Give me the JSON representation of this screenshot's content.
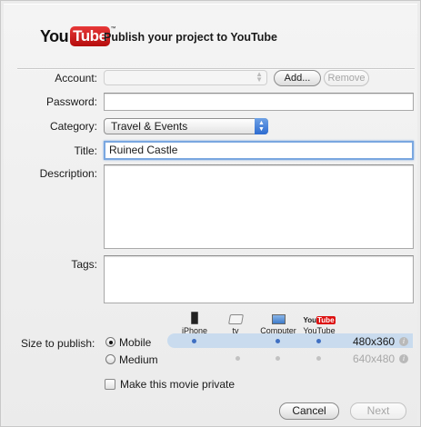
{
  "header": {
    "logo_you": "You",
    "logo_tube": "Tube",
    "logo_tm": "™",
    "title": "Publish your project to YouTube"
  },
  "account": {
    "label": "Account:",
    "add_label": "Add...",
    "remove_label": "Remove"
  },
  "password": {
    "label": "Password:",
    "value": ""
  },
  "category": {
    "label": "Category:",
    "value": "Travel & Events"
  },
  "title_field": {
    "label": "Title:",
    "value": "Ruined Castle"
  },
  "description": {
    "label": "Description:",
    "value": ""
  },
  "tags": {
    "label": "Tags:",
    "value": ""
  },
  "devices": [
    {
      "icon": "iphone-icon",
      "label": "iPhone"
    },
    {
      "icon": "apple-tv-icon",
      "label": "tv"
    },
    {
      "icon": "computer-icon",
      "label": "Computer"
    },
    {
      "icon": "youtube-icon",
      "label": "YouTube"
    }
  ],
  "size": {
    "label": "Size to publish:",
    "options": [
      {
        "label": "Mobile",
        "resolution": "480x360",
        "selected": true
      },
      {
        "label": "Medium",
        "resolution": "640x480",
        "selected": false
      }
    ]
  },
  "private_label": "Make this movie private",
  "buttons": {
    "cancel": "Cancel",
    "next": "Next"
  },
  "colors": {
    "accent": "#3f6fc2",
    "youtube_red": "#d11111",
    "band": "#c9dbee"
  }
}
